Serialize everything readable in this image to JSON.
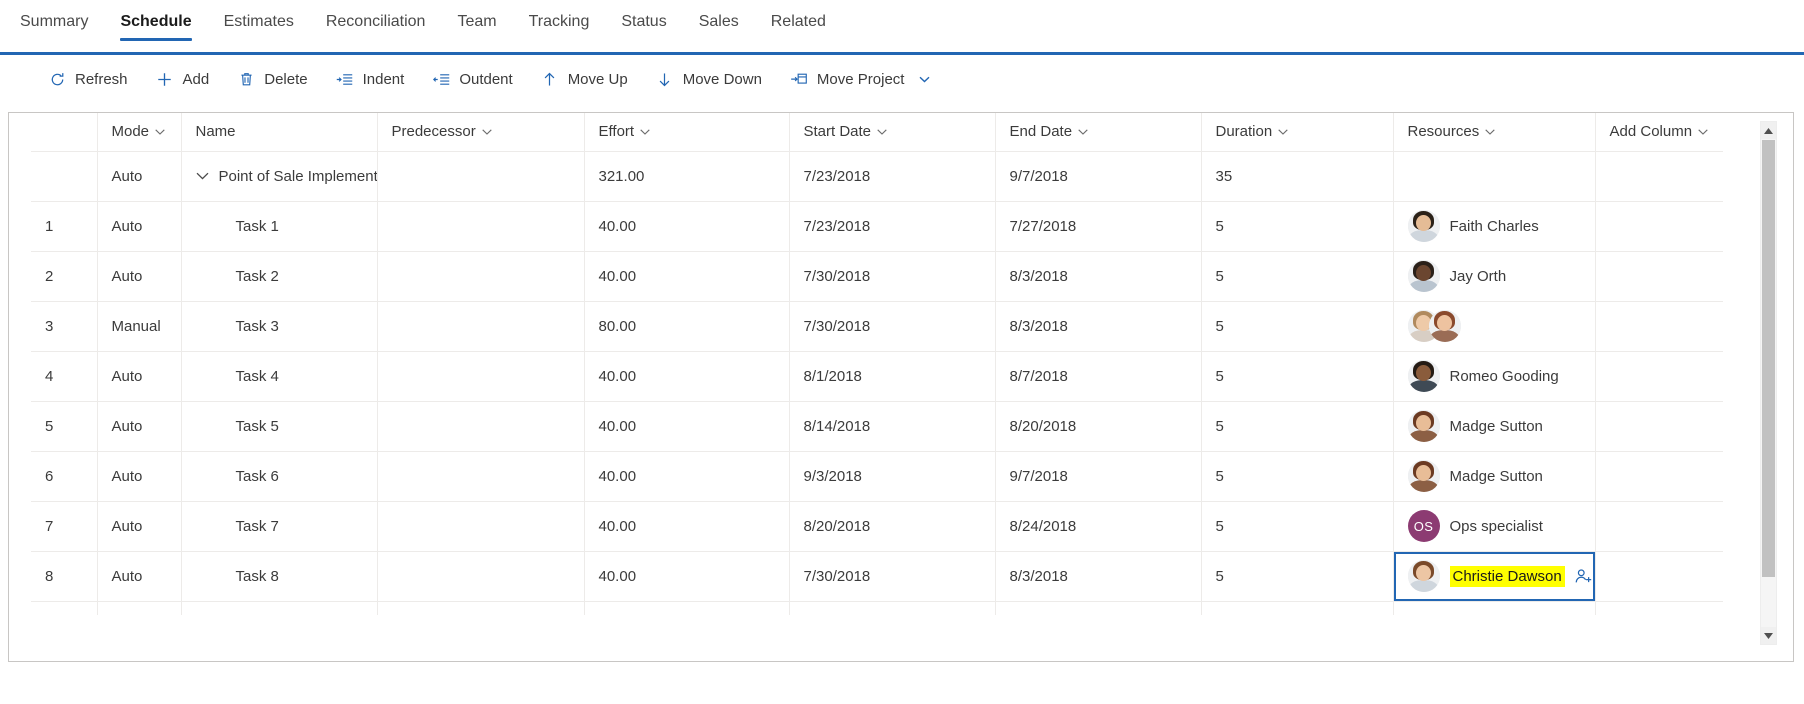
{
  "tabs": [
    {
      "label": "Summary",
      "active": false
    },
    {
      "label": "Schedule",
      "active": true
    },
    {
      "label": "Estimates",
      "active": false
    },
    {
      "label": "Reconciliation",
      "active": false
    },
    {
      "label": "Team",
      "active": false
    },
    {
      "label": "Tracking",
      "active": false
    },
    {
      "label": "Status",
      "active": false
    },
    {
      "label": "Sales",
      "active": false
    },
    {
      "label": "Related",
      "active": false
    }
  ],
  "toolbar": {
    "refresh_label": "Refresh",
    "add_label": "Add",
    "delete_label": "Delete",
    "indent_label": "Indent",
    "outdent_label": "Outdent",
    "move_up_label": "Move Up",
    "move_down_label": "Move Down",
    "move_project_label": "Move Project"
  },
  "grid": {
    "columns": [
      {
        "key": "idx",
        "label": "",
        "chevron": false
      },
      {
        "key": "mode",
        "label": "Mode",
        "chevron": true
      },
      {
        "key": "name",
        "label": "Name",
        "chevron": false
      },
      {
        "key": "pred",
        "label": "Predecessor",
        "chevron": true
      },
      {
        "key": "effort",
        "label": "Effort",
        "chevron": true
      },
      {
        "key": "start",
        "label": "Start Date",
        "chevron": true
      },
      {
        "key": "end",
        "label": "End Date",
        "chevron": true
      },
      {
        "key": "dur",
        "label": "Duration",
        "chevron": true
      },
      {
        "key": "res",
        "label": "Resources",
        "chevron": true
      },
      {
        "key": "add",
        "label": "Add Column",
        "chevron": true
      }
    ],
    "rows": [
      {
        "idx": "",
        "mode": "Auto",
        "name": "Point of Sale Implementat",
        "summary": true,
        "pred": "",
        "effort": "321.00",
        "start": "7/23/2018",
        "end": "9/7/2018",
        "dur": "35",
        "resources": [],
        "selected": false
      },
      {
        "idx": "1",
        "mode": "Auto",
        "name": "Task 1",
        "summary": false,
        "pred": "",
        "effort": "40.00",
        "start": "7/23/2018",
        "end": "7/27/2018",
        "dur": "5",
        "resources": [
          {
            "name": "Faith Charles",
            "type": "photo",
            "hair": "#2b2118",
            "skin": "#e5bc96",
            "body": "#cfd6dd"
          }
        ],
        "selected": false
      },
      {
        "idx": "2",
        "mode": "Auto",
        "name": "Task 2",
        "summary": false,
        "pred": "",
        "effort": "40.00",
        "start": "7/30/2018",
        "end": "8/3/2018",
        "dur": "5",
        "resources": [
          {
            "name": "Jay Orth",
            "type": "photo",
            "hair": "#2a2019",
            "skin": "#6b4630",
            "body": "#b9c4cf"
          }
        ],
        "selected": false
      },
      {
        "idx": "3",
        "mode": "Manual",
        "name": "Task 3",
        "summary": false,
        "pred": "",
        "effort": "80.00",
        "start": "7/30/2018",
        "end": "8/3/2018",
        "dur": "5",
        "resources": [
          {
            "name": "",
            "type": "photo",
            "hair": "#b08a5e",
            "skin": "#eecaa8",
            "body": "#d8cec4"
          },
          {
            "name": "",
            "type": "photo",
            "hair": "#8a4a2d",
            "skin": "#eec3a0",
            "body": "#9a6c55"
          }
        ],
        "selected": false
      },
      {
        "idx": "4",
        "mode": "Auto",
        "name": "Task 4",
        "summary": false,
        "pred": "",
        "effort": "40.00",
        "start": "8/1/2018",
        "end": "8/7/2018",
        "dur": "5",
        "resources": [
          {
            "name": "Romeo Gooding",
            "type": "photo",
            "hair": "#241b14",
            "skin": "#8a5c3c",
            "body": "#3f4a55"
          }
        ],
        "selected": false
      },
      {
        "idx": "5",
        "mode": "Auto",
        "name": "Task 5",
        "summary": false,
        "pred": "",
        "effort": "40.00",
        "start": "8/14/2018",
        "end": "8/20/2018",
        "dur": "5",
        "resources": [
          {
            "name": "Madge Sutton",
            "type": "photo",
            "hair": "#6b3a22",
            "skin": "#e8bd97",
            "body": "#8c5f44"
          }
        ],
        "selected": false
      },
      {
        "idx": "6",
        "mode": "Auto",
        "name": "Task 6",
        "summary": false,
        "pred": "",
        "effort": "40.00",
        "start": "9/3/2018",
        "end": "9/7/2018",
        "dur": "5",
        "resources": [
          {
            "name": "Madge Sutton",
            "type": "photo",
            "hair": "#6b3a22",
            "skin": "#e8bd97",
            "body": "#8c5f44"
          }
        ],
        "selected": false
      },
      {
        "idx": "7",
        "mode": "Auto",
        "name": "Task 7",
        "summary": false,
        "pred": "",
        "effort": "40.00",
        "start": "8/20/2018",
        "end": "8/24/2018",
        "dur": "5",
        "resources": [
          {
            "name": "Ops specialist",
            "type": "initials",
            "initials": "OS",
            "color": "#8c3b72"
          }
        ],
        "selected": false
      },
      {
        "idx": "8",
        "mode": "Auto",
        "name": "Task 8",
        "summary": false,
        "pred": "",
        "effort": "40.00",
        "start": "7/30/2018",
        "end": "8/3/2018",
        "dur": "5",
        "resources": [
          {
            "name": "Christie Dawson",
            "type": "photo",
            "hair": "#7a4a2a",
            "skin": "#edc6a4",
            "body": "#cfd6dd"
          }
        ],
        "selected": true
      }
    ]
  },
  "colors": {
    "accent": "#2266b3",
    "highlight": "#ffff00",
    "selection_border": "#2266b3",
    "initials_avatar": "#8c3b72",
    "grid_line": "#edebe9",
    "container_border": "#c8c6c4"
  }
}
